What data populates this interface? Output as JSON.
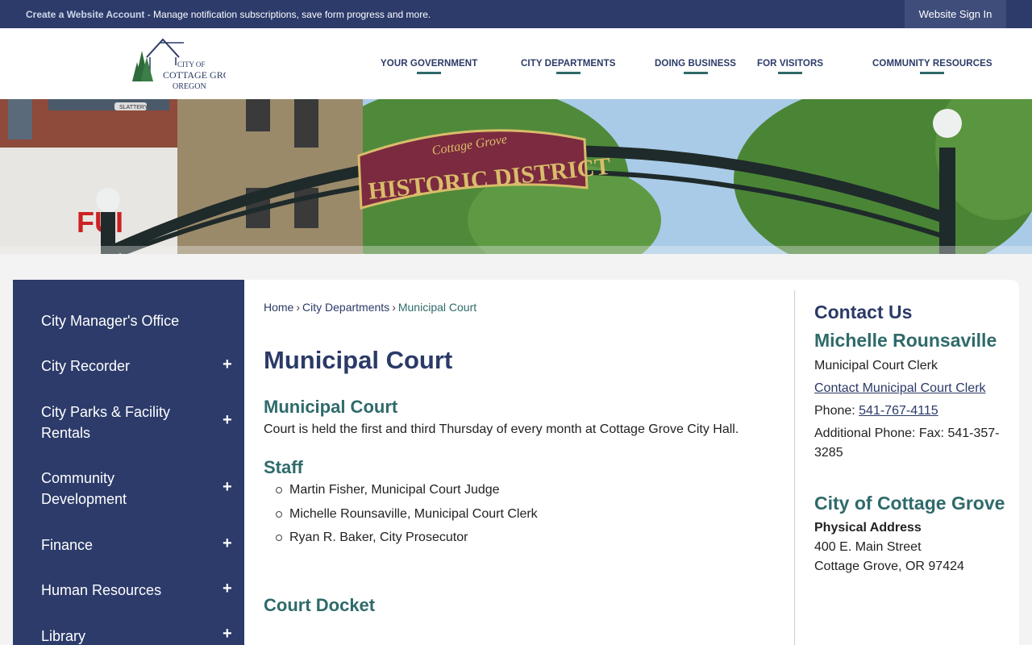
{
  "topbar": {
    "account_link": "Create a Website Account",
    "account_text": " - Manage notification subscriptions, save form progress and more.",
    "signin": "Website Sign In"
  },
  "logo": {
    "line1": "CITY OF",
    "line2": "COTTAGE GROVE",
    "line3": "OREGON"
  },
  "nav": [
    {
      "label": "YOUR GOVERNMENT"
    },
    {
      "label": "CITY DEPARTMENTS"
    },
    {
      "label": "DOING BUSINESS"
    },
    {
      "label": "FOR VISITORS"
    },
    {
      "label": "COMMUNITY RESOURCES"
    }
  ],
  "banner": {
    "sign_top": "Cottage Grove",
    "sign_main": "HISTORIC DISTRICT",
    "street_sign": "SLATTERY",
    "wall_text": "FUI"
  },
  "sidebar": {
    "items": [
      {
        "label": "City Manager's Office"
      },
      {
        "label": "City Recorder",
        "expand": "+"
      },
      {
        "label": "City Parks & Facility Rentals",
        "expand": "+"
      },
      {
        "label": "Community Development",
        "expand": "+"
      },
      {
        "label": "Finance",
        "expand": "+"
      },
      {
        "label": "Human Resources",
        "expand": "+"
      },
      {
        "label": "Library",
        "expand": "+"
      }
    ]
  },
  "breadcrumb": {
    "home": "Home",
    "sep": "›",
    "parent": "City Departments",
    "current": "Municipal Court"
  },
  "main": {
    "title": "Municipal Court",
    "section1_heading": "Municipal Court",
    "section1_text": "Court is held the first and third Thursday of every month at Cottage Grove City Hall.",
    "staff_heading": "Staff",
    "staff": [
      "Martin Fisher, Municipal Court Judge",
      "Michelle Rounsaville, Municipal Court Clerk",
      "Ryan R. Baker, City Prosecutor"
    ],
    "docket_heading": "Court Docket"
  },
  "contact": {
    "title": "Contact Us",
    "name": "Michelle Rounsaville",
    "role": "Municipal Court Clerk",
    "contact_link": "Contact Municipal Court Clerk",
    "phone_label": "Phone: ",
    "phone": "541-767-4115",
    "additional_phone": "Additional Phone: Fax: 541-357-3285",
    "org": "City of Cottage Grove",
    "address_label": "Physical Address",
    "street": "400 E. Main Street",
    "city": "Cottage Grove, OR 97424"
  },
  "colors": {
    "navy": "#2c3b6a",
    "teal": "#2f6a6a",
    "sign_maroon": "#7b2a3f",
    "sign_gold": "#d9bc6a"
  }
}
